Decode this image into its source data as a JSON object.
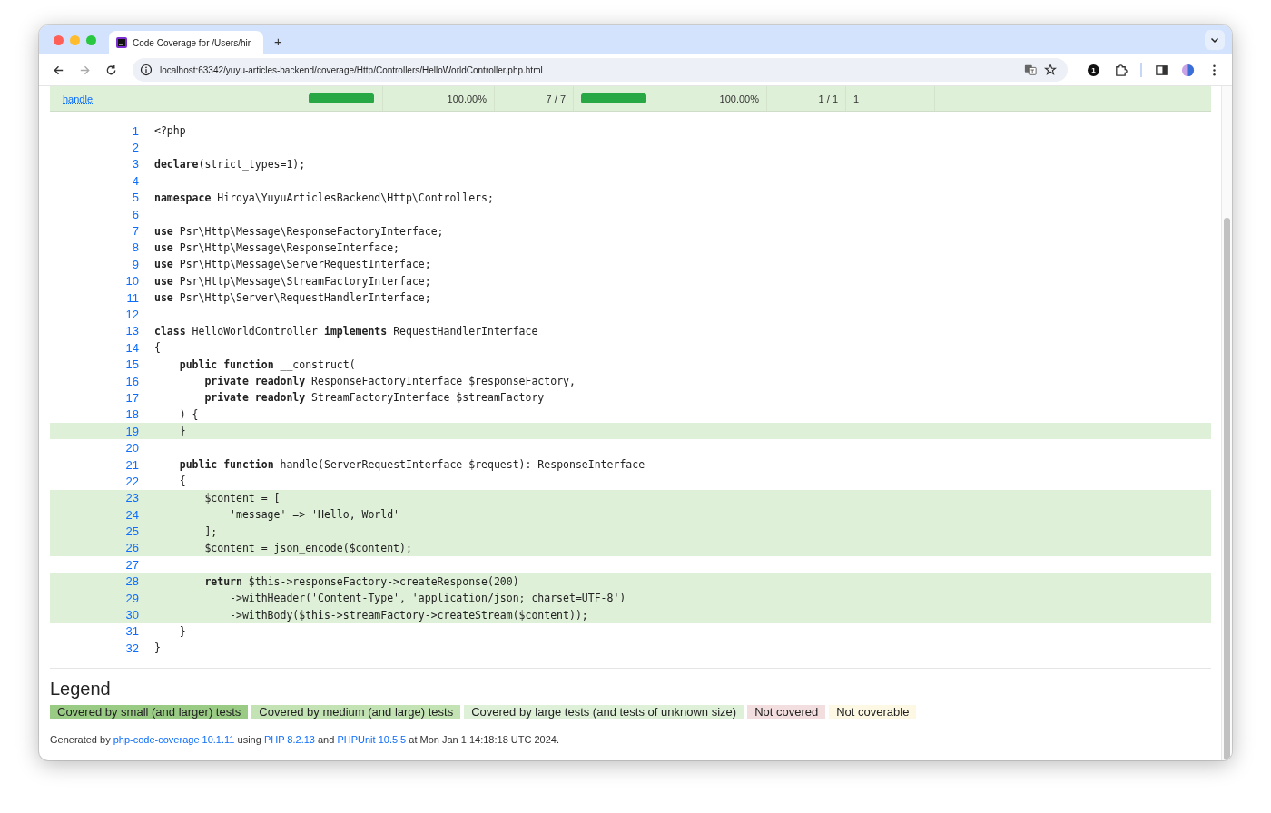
{
  "browser": {
    "tab": {
      "title": "Code Coverage for /Users/hir",
      "selected": true
    },
    "new_tab": "+",
    "url": "localhost:63342/yuyu-articles-backend/coverage/Http/Controllers/HelloWorldController.php.html",
    "extension_badge": "1"
  },
  "summary_row": {
    "name": "handle",
    "lines_bar": {
      "level": 1
    },
    "lines_percent": "100.00%",
    "lines_count": "7 / 7",
    "methods_bar": {
      "level": 1
    },
    "methods_percent": "100.00%",
    "methods_count": "1 / 1",
    "crap": "1"
  },
  "code_lines": [
    {
      "number": "1",
      "text": "<?php",
      "covered": false
    },
    {
      "number": "2",
      "covered": false
    },
    {
      "number": "3",
      "text": "**declare**(strict_types=1);",
      "covered": false
    },
    {
      "number": "4",
      "covered": false
    },
    {
      "number": "5",
      "text": "**namespace** Hiroya\\YuyuArticlesBackend\\Http\\Controllers;",
      "covered": false
    },
    {
      "number": "6",
      "covered": false
    },
    {
      "number": "7",
      "text": "**use** Psr\\Http\\Message\\ResponseFactoryInterface;",
      "covered": false
    },
    {
      "number": "8",
      "text": "**use** Psr\\Http\\Message\\ResponseInterface;",
      "covered": false
    },
    {
      "number": "9",
      "text": "**use** Psr\\Http\\Message\\ServerRequestInterface;",
      "covered": false
    },
    {
      "number": "10",
      "text": "**use** Psr\\Http\\Message\\StreamFactoryInterface;",
      "covered": false
    },
    {
      "number": "11",
      "text": "**use** Psr\\Http\\Server\\RequestHandlerInterface;",
      "covered": false
    },
    {
      "number": "12",
      "covered": false
    },
    {
      "number": "13",
      "text": "**class** HelloWorldController **implements** RequestHandlerInterface",
      "covered": false
    },
    {
      "number": "14",
      "text": "{",
      "covered": false
    },
    {
      "number": "15",
      "text": "    **public** **function** __construct(",
      "covered": false
    },
    {
      "number": "16",
      "text": "        **private** **readonly** ResponseFactoryInterface $responseFactory,",
      "covered": false
    },
    {
      "number": "17",
      "text": "        **private** **readonly** StreamFactoryInterface $streamFactory",
      "covered": false
    },
    {
      "number": "18",
      "text": "    ) {",
      "covered": false
    },
    {
      "number": "19",
      "text": "    }",
      "covered": true
    },
    {
      "number": "20",
      "covered": false
    },
    {
      "number": "21",
      "text": "    **public** **function** handle(ServerRequestInterface $request): ResponseInterface",
      "covered": false
    },
    {
      "number": "22",
      "text": "    {",
      "covered": false
    },
    {
      "number": "23",
      "text": "        $content = [",
      "covered": true
    },
    {
      "number": "24",
      "text": "            'message' => 'Hello, World'",
      "covered": true
    },
    {
      "number": "25",
      "text": "        ];",
      "covered": true
    },
    {
      "number": "26",
      "text": "        $content = json_encode($content);",
      "covered": true
    },
    {
      "number": "27",
      "covered": false
    },
    {
      "number": "28",
      "text": "        **return** $this->responseFactory->createResponse(200)",
      "covered": true
    },
    {
      "number": "29",
      "text": "            ->withHeader('Content-Type', 'application/json; charset=UTF-8')",
      "covered": true
    },
    {
      "number": "30",
      "text": "            ->withBody($this->streamFactory->createStream($content));",
      "covered": true
    },
    {
      "number": "31",
      "text": "    }",
      "covered": false
    },
    {
      "number": "32",
      "text": "}",
      "covered": false
    }
  ],
  "legend": {
    "title": "Legend",
    "items": [
      {
        "label": "Covered by small (and larger) tests",
        "color": "#99cb84"
      },
      {
        "label": "Covered by medium (and large) tests",
        "color": "#c3e3b5"
      },
      {
        "label": "Covered by large tests (and tests of unknown size)",
        "color": "#dff0d8"
      },
      {
        "label": "Not covered",
        "color": "#f2dede"
      },
      {
        "label": "Not coverable",
        "color": "#fcf8e3"
      }
    ]
  },
  "footer": [
    {
      "kind": "text",
      "text": "Generated by"
    },
    {
      "kind": "link",
      "text": "php-code-coverage 10.1.11"
    },
    {
      "kind": "text",
      "text": "using"
    },
    {
      "kind": "link",
      "text": "PHP 8.2.13"
    },
    {
      "kind": "text",
      "text": "and"
    },
    {
      "kind": "link",
      "text": "PHPUnit 10.5.5"
    },
    {
      "kind": "text",
      "text": "at Mon Jan 1 14:18:18 UTC 2024."
    }
  ]
}
